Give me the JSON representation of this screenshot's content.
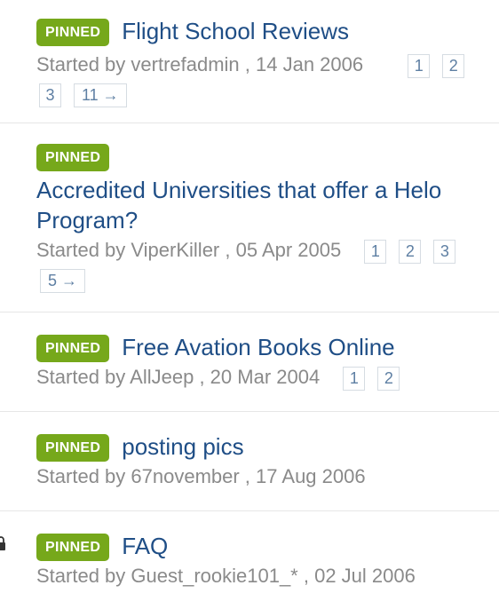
{
  "topics": [
    {
      "badge": "PINNED",
      "title": "Flight School Reviews",
      "meta": "Started by vertrefadmin , 14 Jan 2006",
      "pages_row1": [
        "1",
        "2"
      ],
      "pages_row2": [
        "3",
        "11 →"
      ]
    },
    {
      "badge": "PINNED",
      "title": "Accredited Universities that offer a Helo Program?",
      "meta": "Started by ViperKiller , 05 Apr 2005",
      "pages_row1": [
        "1",
        "2",
        "3"
      ],
      "pages_row2": [
        "5 →"
      ]
    },
    {
      "badge": "PINNED",
      "title": "Free Avation Books Online",
      "meta": "Started by AllJeep , 20 Mar 2004",
      "pages_row1": [
        "1",
        "2"
      ]
    },
    {
      "badge": "PINNED",
      "title": "posting pics",
      "meta": "Started by 67november , 17 Aug 2006"
    },
    {
      "badge": "PINNED",
      "title": "FAQ",
      "meta": "Started by Guest_rookie101_* , 02 Jul 2006",
      "status_icon": "lock-icon"
    }
  ],
  "colors": {
    "badge_bg": "#76a81b",
    "title_link": "#1f4e86",
    "meta_text": "#8a8a8a",
    "pager_text": "#5e7fa3",
    "pager_border": "#d6dce2",
    "divider": "#e6e6e6"
  }
}
